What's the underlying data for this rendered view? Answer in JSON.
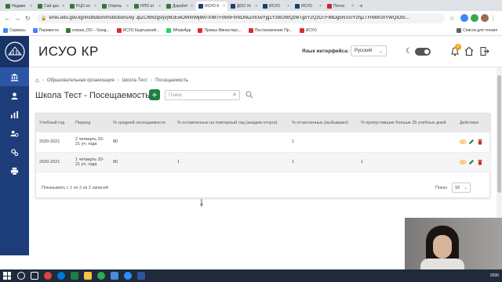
{
  "browser": {
    "tabs": [
      {
        "label": "Недавн",
        "color": "#2e7d32"
      },
      {
        "label": "Сай цен",
        "color": "#2e7d32"
      },
      {
        "label": "РЦО оп",
        "color": "#2e7d32"
      },
      {
        "label": "Ответы",
        "color": "#2e7d32"
      },
      {
        "label": "НПО от",
        "color": "#2e7d32"
      },
      {
        "label": "Доработ",
        "color": "#2e7d32"
      },
      {
        "label": "ИСУО К",
        "color": "#1d3c7a"
      },
      {
        "label": "ДОО Ук",
        "color": "#1d3c7a"
      },
      {
        "label": "ИСУО",
        "color": "#1d3c7a"
      },
      {
        "label": "ИСУО",
        "color": "#1d3c7a"
      },
      {
        "label": "Почта",
        "color": "#c62828"
      }
    ],
    "active_tab_index": 6,
    "url": "emis.edu.gov.kg/Institution/Institutions/ey JpZCI6NzgsIjVjM2EwOWImMjliMTI0MTFiNmFmNDhkZmUwYjg1YzIkOWQzMTgxY2QzOTFlMDg5NTc0YzhjZTFlNWU0YWQiOiS...",
    "bookmarks": [
      {
        "label": "Сервисы",
        "color": "#4285f4"
      },
      {
        "label": "Перевести",
        "color": "#4285f4"
      },
      {
        "label": "списки_ОО – Goog...",
        "color": "#2e7d32"
      },
      {
        "label": "ИСУО Кыргызской...",
        "color": "#d32f2f"
      },
      {
        "label": "WhatsApp",
        "color": "#25d366"
      },
      {
        "label": "Приказ Министерс...",
        "color": "#d32f2f"
      },
      {
        "label": "Постановление Пр...",
        "color": "#d32f2f"
      },
      {
        "label": "ИСУО",
        "color": "#d32f2f"
      }
    ],
    "reading_list": "Список для чтения"
  },
  "app": {
    "title": "ИСУО КР",
    "language_label": "Язык интерфейса:",
    "language_value": "Русский",
    "notification_count": "0",
    "sidebar_icons": [
      "bank-icon",
      "user-icon",
      "chart-icon",
      "users-cog-icon",
      "settings-icon",
      "print-icon"
    ]
  },
  "breadcrumb": {
    "items": [
      "Образовательная организация",
      "Школа Тест",
      "Посещаемость"
    ]
  },
  "page": {
    "title": "Школа Тест - Посещаемость",
    "add_label": "+",
    "search_placeholder": "Поиск"
  },
  "table": {
    "headers": [
      "Учебный год",
      "Период",
      "% средней посещаемости",
      "% оставленных на повторный год (академ отпуск)",
      "% отчисленных (выбывших)",
      "% пропустивших больше 25 учебных дней",
      "Действия"
    ],
    "rows": [
      [
        "2020-2021",
        "2 четверть 20-21 уч. года",
        "80",
        "",
        "1",
        "",
        ""
      ],
      [
        "2020-2021",
        "1 четверть 20-21 уч. года",
        "80",
        "1",
        "1",
        "1",
        ""
      ]
    ],
    "footer": "Показывать с 1 по 2 из 2 записей",
    "page_size_label": "Показ",
    "page_size": "10"
  },
  "taskbar": {
    "clock": "2030"
  },
  "colors": {
    "sidebar": "#1d3c7a",
    "accent_green": "#1e7d42",
    "view_icon": "#f0a020",
    "edit_icon": "#2e7d32",
    "delete_icon": "#c62828"
  }
}
